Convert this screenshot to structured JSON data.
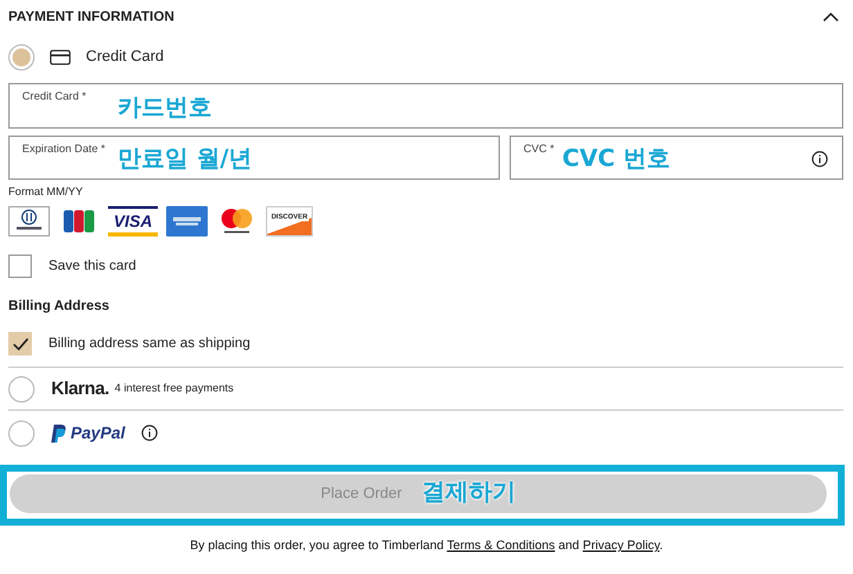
{
  "section": {
    "title": "PAYMENT INFORMATION",
    "expanded": true
  },
  "methods": [
    {
      "kind": "card",
      "label": "Credit Card",
      "selected": true
    },
    {
      "kind": "klarna",
      "label": "Klarna.",
      "note": "4 interest free payments",
      "selected": false
    },
    {
      "kind": "paypal",
      "label": "PayPal",
      "selected": false
    }
  ],
  "fields": {
    "card_number": {
      "label": "Credit Card *",
      "annotation": "카드번호"
    },
    "expiration": {
      "label": "Expiration Date *",
      "annotation": "만료일 월/년",
      "hint": "Format MM/YY"
    },
    "cvc": {
      "label": "CVC *",
      "annotation": "CVC 번호"
    }
  },
  "card_logos": [
    {
      "kind": "diners"
    },
    {
      "kind": "jcb"
    },
    {
      "kind": "visa",
      "label": "VISA"
    },
    {
      "kind": "amex"
    },
    {
      "kind": "mastercard"
    },
    {
      "kind": "discover",
      "label": "DISCOVER"
    }
  ],
  "save_card": {
    "label": "Save this card",
    "checked": false
  },
  "billing": {
    "title": "Billing Address",
    "same_as_shipping": {
      "label": "Billing address same as shipping",
      "checked": true
    }
  },
  "place_order": {
    "label": "Place Order",
    "annotation": "결제하기",
    "disabled": true,
    "highlighted": true
  },
  "footer": {
    "text": "By placing this order, you agree to Timberland",
    "terms": "Terms & Conditions",
    "and": "and",
    "privacy": "Privacy Policy",
    "end": "."
  }
}
